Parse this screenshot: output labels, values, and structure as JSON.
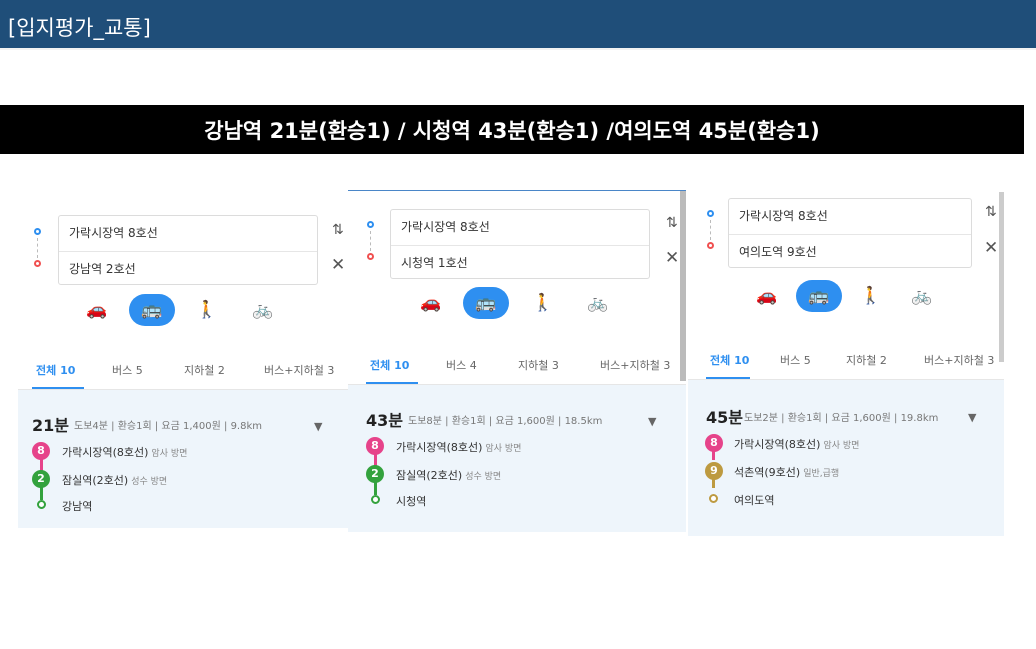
{
  "title": "[입지평가_교통]",
  "headline": "강남역 21분(환승1) / 시청역 43분(환승1) /여의도역 45분(환승1)",
  "colors": {
    "titlebar": "#1f4e79",
    "accent": "#2e8ff0",
    "line8": "#e6438a",
    "line2": "#33a23d",
    "line9": "#bd9a40",
    "result_bg": "#eef5fb"
  },
  "icons": {
    "swap": "swap-icon",
    "close": "close-icon",
    "car": "car-icon",
    "bus": "bus-icon",
    "walk": "walk-icon",
    "bike": "bike-icon",
    "expand": "chevron-down-icon"
  },
  "panels": [
    {
      "from": "가락시장역 8호선",
      "to": "강남역 2호선",
      "tabs": [
        "전체 10",
        "버스 5",
        "지하철 2",
        "버스+지하철 3"
      ],
      "route": {
        "time": "21분",
        "walk": "도보4분",
        "transfer": "환승1회",
        "fare": "요금 1,400원",
        "distance": "9.8km",
        "legs": [
          {
            "badge": "8",
            "station": "가락시장역(8호선)",
            "direction": "암사 방면"
          },
          {
            "badge": "2",
            "station": "잠실역(2호선)",
            "direction": "성수 방면"
          }
        ],
        "destination": "강남역"
      }
    },
    {
      "from": "가락시장역 8호선",
      "to": "시청역 1호선",
      "tabs": [
        "전체 10",
        "버스 4",
        "지하철 3",
        "버스+지하철 3"
      ],
      "route": {
        "time": "43분",
        "walk": "도보8분",
        "transfer": "환승1회",
        "fare": "요금 1,600원",
        "distance": "18.5km",
        "legs": [
          {
            "badge": "8",
            "station": "가락시장역(8호선)",
            "direction": "암사 방면"
          },
          {
            "badge": "2",
            "station": "잠실역(2호선)",
            "direction": "성수 방면"
          }
        ],
        "destination": "시청역"
      }
    },
    {
      "from": "가락시장역 8호선",
      "to": "여의도역 9호선",
      "tabs": [
        "전체 10",
        "버스 5",
        "지하철 2",
        "버스+지하철 3"
      ],
      "route": {
        "time": "45분",
        "walk": "도보2분",
        "transfer": "환승1회",
        "fare": "요금 1,600원",
        "distance": "19.8km",
        "legs": [
          {
            "badge": "8",
            "station": "가락시장역(8호선)",
            "direction": "암사 방면"
          },
          {
            "badge": "9",
            "station": "석촌역(9호선)",
            "direction": "일반,급행"
          }
        ],
        "destination": "여의도역"
      }
    }
  ]
}
